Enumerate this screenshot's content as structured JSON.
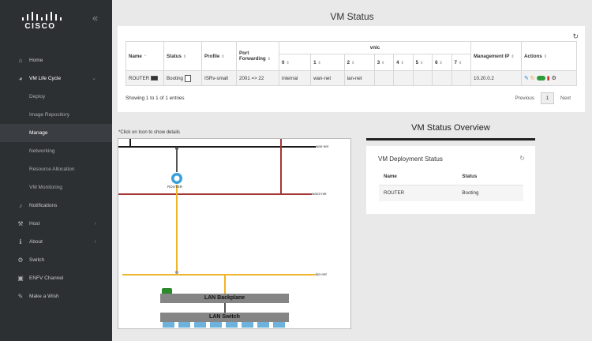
{
  "brand": {
    "name": "CISCO"
  },
  "sidebar": {
    "collapse": "«",
    "items": [
      {
        "label": "Home",
        "icon": "home-icon",
        "glyph": "⌂"
      },
      {
        "label": "VM Life Cycle",
        "icon": "lifecycle-icon",
        "glyph": "◕",
        "expanded": true
      },
      {
        "label": "Notifications",
        "icon": "bell-icon",
        "glyph": "♪"
      },
      {
        "label": "Host",
        "icon": "wrench-icon",
        "glyph": "⚒"
      },
      {
        "label": "About",
        "icon": "info-icon",
        "glyph": "ℹ"
      },
      {
        "label": "Switch",
        "icon": "cogs-icon",
        "glyph": "⚙"
      },
      {
        "label": "ENFV Channel",
        "icon": "channel-icon",
        "glyph": "▣"
      },
      {
        "label": "Make a Wish",
        "icon": "wand-icon",
        "glyph": "✎"
      }
    ],
    "sub_items": [
      "Deploy",
      "Image Repository",
      "Manage",
      "Networking",
      "Resource Allocation",
      "VM Monitoring"
    ],
    "current_sub": "Manage"
  },
  "page": {
    "title": "VM Status"
  },
  "vm_table": {
    "headers": {
      "name": "Name",
      "status": "Status",
      "profile": "Profile",
      "port_forwarding": "Port Forwarding",
      "vnic": "vnic",
      "vnic_cols": [
        "0",
        "1",
        "2",
        "3",
        "4",
        "5",
        "6",
        "7"
      ],
      "management_ip": "Management IP",
      "actions": "Actions"
    },
    "rows": [
      {
        "name": "ROUTER",
        "status": "Booting",
        "profile": "ISRv-small",
        "port_forwarding": "2001 => 22",
        "vnic": [
          "internal",
          "wan-net",
          "lan-net",
          "",
          "",
          "",
          "",
          ""
        ],
        "management_ip": "10.20.0.2"
      }
    ],
    "entries_text": "Showing 1 to 1 of 1 entries",
    "pager": {
      "previous": "Previous",
      "page": "1",
      "next": "Next"
    }
  },
  "topology": {
    "hint": "*Click on Icon to show details",
    "networks": [
      "wan-net",
      "wan2-net",
      "lan-net"
    ],
    "router_label": "ROUTER",
    "backplane": "LAN Backplane",
    "switch": "LAN Switch",
    "colors": {
      "wan": "#1a1a1a",
      "wan2": "#a33535",
      "lan": "#f0b429",
      "router": "#3aa0d8"
    }
  },
  "overview": {
    "title": "VM Status Overview",
    "deployment_title": "VM Deployment Status",
    "headers": {
      "name": "Name",
      "status": "Status"
    },
    "rows": [
      {
        "name": "ROUTER",
        "status": "Booting"
      }
    ]
  }
}
